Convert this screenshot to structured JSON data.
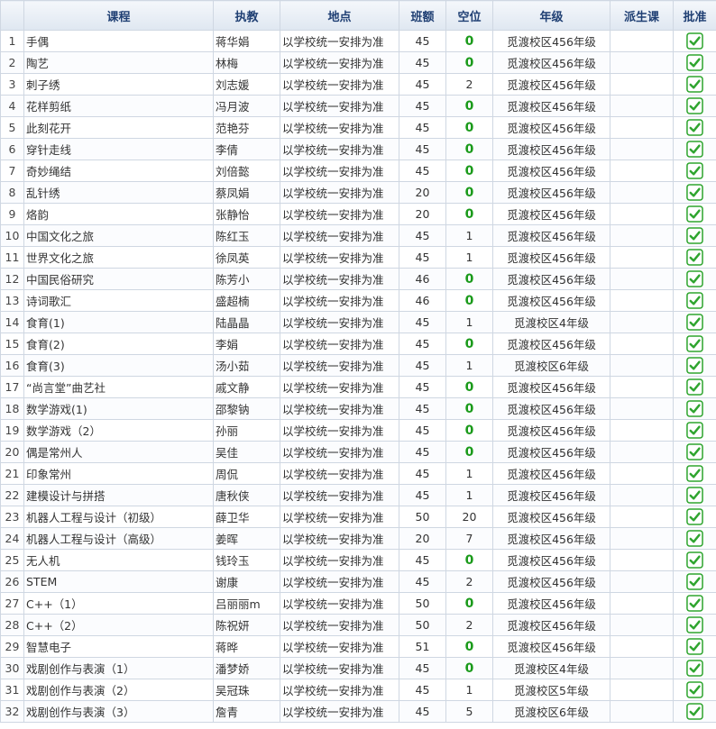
{
  "headers": [
    "",
    "课程",
    "执教",
    "地点",
    "班额",
    "空位",
    "年级",
    "派生课",
    "批准"
  ],
  "rows": [
    {
      "n": "1",
      "course": "手偶",
      "teacher": "蒋华娟",
      "place": "以学校统一安排为准",
      "cap": "45",
      "vac": "0",
      "grade": "觅渡校区456年级"
    },
    {
      "n": "2",
      "course": "陶艺",
      "teacher": "林梅",
      "place": "以学校统一安排为准",
      "cap": "45",
      "vac": "0",
      "grade": "觅渡校区456年级"
    },
    {
      "n": "3",
      "course": "刺子绣",
      "teacher": "刘志媛",
      "place": "以学校统一安排为准",
      "cap": "45",
      "vac": "2",
      "grade": "觅渡校区456年级"
    },
    {
      "n": "4",
      "course": "花样剪纸",
      "teacher": "冯月波",
      "place": "以学校统一安排为准",
      "cap": "45",
      "vac": "0",
      "grade": "觅渡校区456年级"
    },
    {
      "n": "5",
      "course": "此刻花开",
      "teacher": "范艳芬",
      "place": "以学校统一安排为准",
      "cap": "45",
      "vac": "0",
      "grade": "觅渡校区456年级"
    },
    {
      "n": "6",
      "course": "穿针走线",
      "teacher": "李倩",
      "place": "以学校统一安排为准",
      "cap": "45",
      "vac": "0",
      "grade": "觅渡校区456年级"
    },
    {
      "n": "7",
      "course": "奇妙绳结",
      "teacher": "刘倍懿",
      "place": "以学校统一安排为准",
      "cap": "45",
      "vac": "0",
      "grade": "觅渡校区456年级"
    },
    {
      "n": "8",
      "course": "乱针绣",
      "teacher": "蔡凤娟",
      "place": "以学校统一安排为准",
      "cap": "20",
      "vac": "0",
      "grade": "觅渡校区456年级"
    },
    {
      "n": "9",
      "course": "烙韵",
      "teacher": "张静怡",
      "place": "以学校统一安排为准",
      "cap": "20",
      "vac": "0",
      "grade": "觅渡校区456年级"
    },
    {
      "n": "10",
      "course": "中国文化之旅",
      "teacher": "陈红玉",
      "place": "以学校统一安排为准",
      "cap": "45",
      "vac": "1",
      "grade": "觅渡校区456年级"
    },
    {
      "n": "11",
      "course": "世界文化之旅",
      "teacher": "徐凤英",
      "place": "以学校统一安排为准",
      "cap": "45",
      "vac": "1",
      "grade": "觅渡校区456年级"
    },
    {
      "n": "12",
      "course": "中国民俗研究",
      "teacher": "陈芳小",
      "place": "以学校统一安排为准",
      "cap": "46",
      "vac": "0",
      "grade": "觅渡校区456年级"
    },
    {
      "n": "13",
      "course": "诗词歌汇",
      "teacher": "盛超楠",
      "place": "以学校统一安排为准",
      "cap": "46",
      "vac": "0",
      "grade": "觅渡校区456年级"
    },
    {
      "n": "14",
      "course": "食育(1)",
      "teacher": "陆晶晶",
      "place": "以学校统一安排为准",
      "cap": "45",
      "vac": "1",
      "grade": "觅渡校区4年级"
    },
    {
      "n": "15",
      "course": "食育(2)",
      "teacher": "李娟",
      "place": "以学校统一安排为准",
      "cap": "45",
      "vac": "0",
      "grade": "觅渡校区456年级"
    },
    {
      "n": "16",
      "course": "食育(3)",
      "teacher": "汤小茹",
      "place": "以学校统一安排为准",
      "cap": "45",
      "vac": "1",
      "grade": "觅渡校区6年级"
    },
    {
      "n": "17",
      "course": "“尚言堂”曲艺社",
      "teacher": "戚文静",
      "place": "以学校统一安排为准",
      "cap": "45",
      "vac": "0",
      "grade": "觅渡校区456年级"
    },
    {
      "n": "18",
      "course": "数学游戏(1)",
      "teacher": "邵黎钠",
      "place": "以学校统一安排为准",
      "cap": "45",
      "vac": "0",
      "grade": "觅渡校区456年级"
    },
    {
      "n": "19",
      "course": "数学游戏（2）",
      "teacher": "孙丽",
      "place": "以学校统一安排为准",
      "cap": "45",
      "vac": "0",
      "grade": "觅渡校区456年级"
    },
    {
      "n": "20",
      "course": "偶是常州人",
      "teacher": "吴佳",
      "place": "以学校统一安排为准",
      "cap": "45",
      "vac": "0",
      "grade": "觅渡校区456年级"
    },
    {
      "n": "21",
      "course": "印象常州",
      "teacher": "周侃",
      "place": "以学校统一安排为准",
      "cap": "45",
      "vac": "1",
      "grade": "觅渡校区456年级"
    },
    {
      "n": "22",
      "course": "建模设计与拼搭",
      "teacher": "唐秋侠",
      "place": "以学校统一安排为准",
      "cap": "45",
      "vac": "1",
      "grade": "觅渡校区456年级"
    },
    {
      "n": "23",
      "course": "机器人工程与设计（初级）",
      "teacher": "薛卫华",
      "place": "以学校统一安排为准",
      "cap": "50",
      "vac": "20",
      "grade": "觅渡校区456年级"
    },
    {
      "n": "24",
      "course": "机器人工程与设计（高级）",
      "teacher": "姜晖",
      "place": "以学校统一安排为准",
      "cap": "20",
      "vac": "7",
      "grade": "觅渡校区456年级"
    },
    {
      "n": "25",
      "course": "无人机",
      "teacher": "钱玲玉",
      "place": "以学校统一安排为准",
      "cap": "45",
      "vac": "0",
      "grade": "觅渡校区456年级"
    },
    {
      "n": "26",
      "course": "STEM",
      "teacher": "谢康",
      "place": "以学校统一安排为准",
      "cap": "45",
      "vac": "2",
      "grade": "觅渡校区456年级"
    },
    {
      "n": "27",
      "course": "C++（1）",
      "teacher": "吕丽丽m",
      "place": "以学校统一安排为准",
      "cap": "50",
      "vac": "0",
      "grade": "觅渡校区456年级"
    },
    {
      "n": "28",
      "course": "C++（2）",
      "teacher": "陈祝妍",
      "place": "以学校统一安排为准",
      "cap": "50",
      "vac": "2",
      "grade": "觅渡校区456年级"
    },
    {
      "n": "29",
      "course": "智慧电子",
      "teacher": "蒋晔",
      "place": "以学校统一安排为准",
      "cap": "51",
      "vac": "0",
      "grade": "觅渡校区456年级"
    },
    {
      "n": "30",
      "course": "戏剧创作与表演（1）",
      "teacher": "潘梦娇",
      "place": "以学校统一安排为准",
      "cap": "45",
      "vac": "0",
      "grade": "觅渡校区4年级"
    },
    {
      "n": "31",
      "course": "戏剧创作与表演（2）",
      "teacher": "吴冠珠",
      "place": "以学校统一安排为准",
      "cap": "45",
      "vac": "1",
      "grade": "觅渡校区5年级"
    },
    {
      "n": "32",
      "course": "戏剧创作与表演（3）",
      "teacher": "詹青",
      "place": "以学校统一安排为准",
      "cap": "45",
      "vac": "5",
      "grade": "觅渡校区6年级"
    }
  ],
  "approve_icon": "check-icon",
  "colors": {
    "header_text": "#1f3f73",
    "zero_vacancy": "#1a9a1a",
    "check_green": "#2fa52f"
  }
}
